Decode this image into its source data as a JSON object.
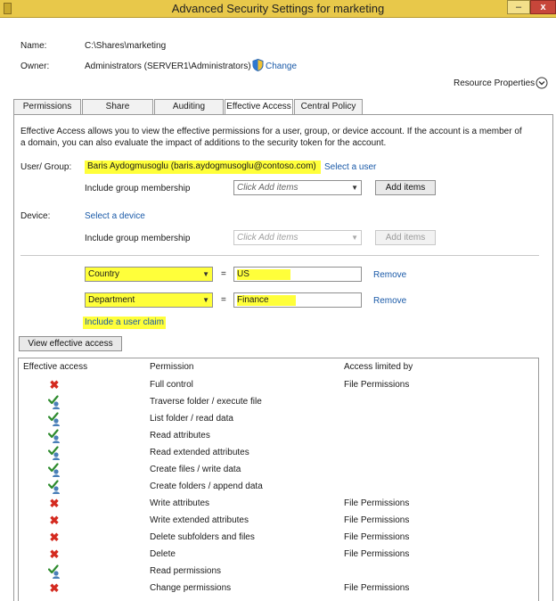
{
  "window": {
    "title": "Advanced Security Settings for marketing",
    "minimize_glyph": "–",
    "close_glyph": "x"
  },
  "header": {
    "name_label": "Name:",
    "name_value": "C:\\Shares\\marketing",
    "owner_label": "Owner:",
    "owner_value": "Administrators (SERVER1\\Administrators)",
    "change_link": "Change",
    "resource_properties": "Resource Properties"
  },
  "tabs": [
    {
      "label": "Permissions",
      "active": false
    },
    {
      "label": "Share",
      "active": false
    },
    {
      "label": "Auditing",
      "active": false
    },
    {
      "label": "Effective Access",
      "active": true
    },
    {
      "label": "Central Policy",
      "active": false
    }
  ],
  "effective_access": {
    "description": "Effective Access allows you to view the effective permissions for a user, group, or device account. If the account is a member of a domain, you can also evaluate the impact of additions to the security token for the account.",
    "user_group_label": "User/ Group:",
    "user_value": "Baris Aydogmusoglu (baris.aydogmusoglu@contoso.com)",
    "select_user_link": "Select a user",
    "include_group_label_user": "Include group membership",
    "user_group_placeholder": "Click Add items",
    "user_add_items": "Add items",
    "device_label": "Device:",
    "select_device_link": "Select a device",
    "include_group_label_device": "Include group membership",
    "device_group_placeholder": "Click Add items",
    "device_add_items": "Add items",
    "claims": [
      {
        "attribute": "Country",
        "operator": "=",
        "value": "US",
        "remove": "Remove"
      },
      {
        "attribute": "Department",
        "operator": "=",
        "value": "Finance",
        "remove": "Remove"
      }
    ],
    "include_claim_link": "Include a user claim",
    "view_button": "View effective access"
  },
  "results": {
    "columns": [
      "Effective access",
      "Permission",
      "Access limited by"
    ],
    "rows": [
      {
        "access": "deny",
        "permission": "Full control",
        "limited_by": "File Permissions"
      },
      {
        "access": "allow",
        "permission": "Traverse folder / execute file",
        "limited_by": ""
      },
      {
        "access": "allow",
        "permission": "List folder / read data",
        "limited_by": ""
      },
      {
        "access": "allow",
        "permission": "Read attributes",
        "limited_by": ""
      },
      {
        "access": "allow",
        "permission": "Read extended attributes",
        "limited_by": ""
      },
      {
        "access": "allow",
        "permission": "Create files / write data",
        "limited_by": ""
      },
      {
        "access": "allow",
        "permission": "Create folders / append data",
        "limited_by": ""
      },
      {
        "access": "deny",
        "permission": "Write attributes",
        "limited_by": "File Permissions"
      },
      {
        "access": "deny",
        "permission": "Write extended attributes",
        "limited_by": "File Permissions"
      },
      {
        "access": "deny",
        "permission": "Delete subfolders and files",
        "limited_by": "File Permissions"
      },
      {
        "access": "deny",
        "permission": "Delete",
        "limited_by": "File Permissions"
      },
      {
        "access": "allow",
        "permission": "Read permissions",
        "limited_by": ""
      },
      {
        "access": "deny",
        "permission": "Change permissions",
        "limited_by": "File Permissions"
      }
    ]
  },
  "icons": {
    "deny": "red-x-icon",
    "allow": "green-check-user-icon",
    "shield": "uac-shield-icon",
    "expand": "chevron-down-circle-icon"
  },
  "colors": {
    "highlight": "#ffff3a",
    "link": "#1a5aa8",
    "deny": "#d42a1f",
    "allow": "#2e8b2e",
    "titlebar": "#e8c84a"
  }
}
